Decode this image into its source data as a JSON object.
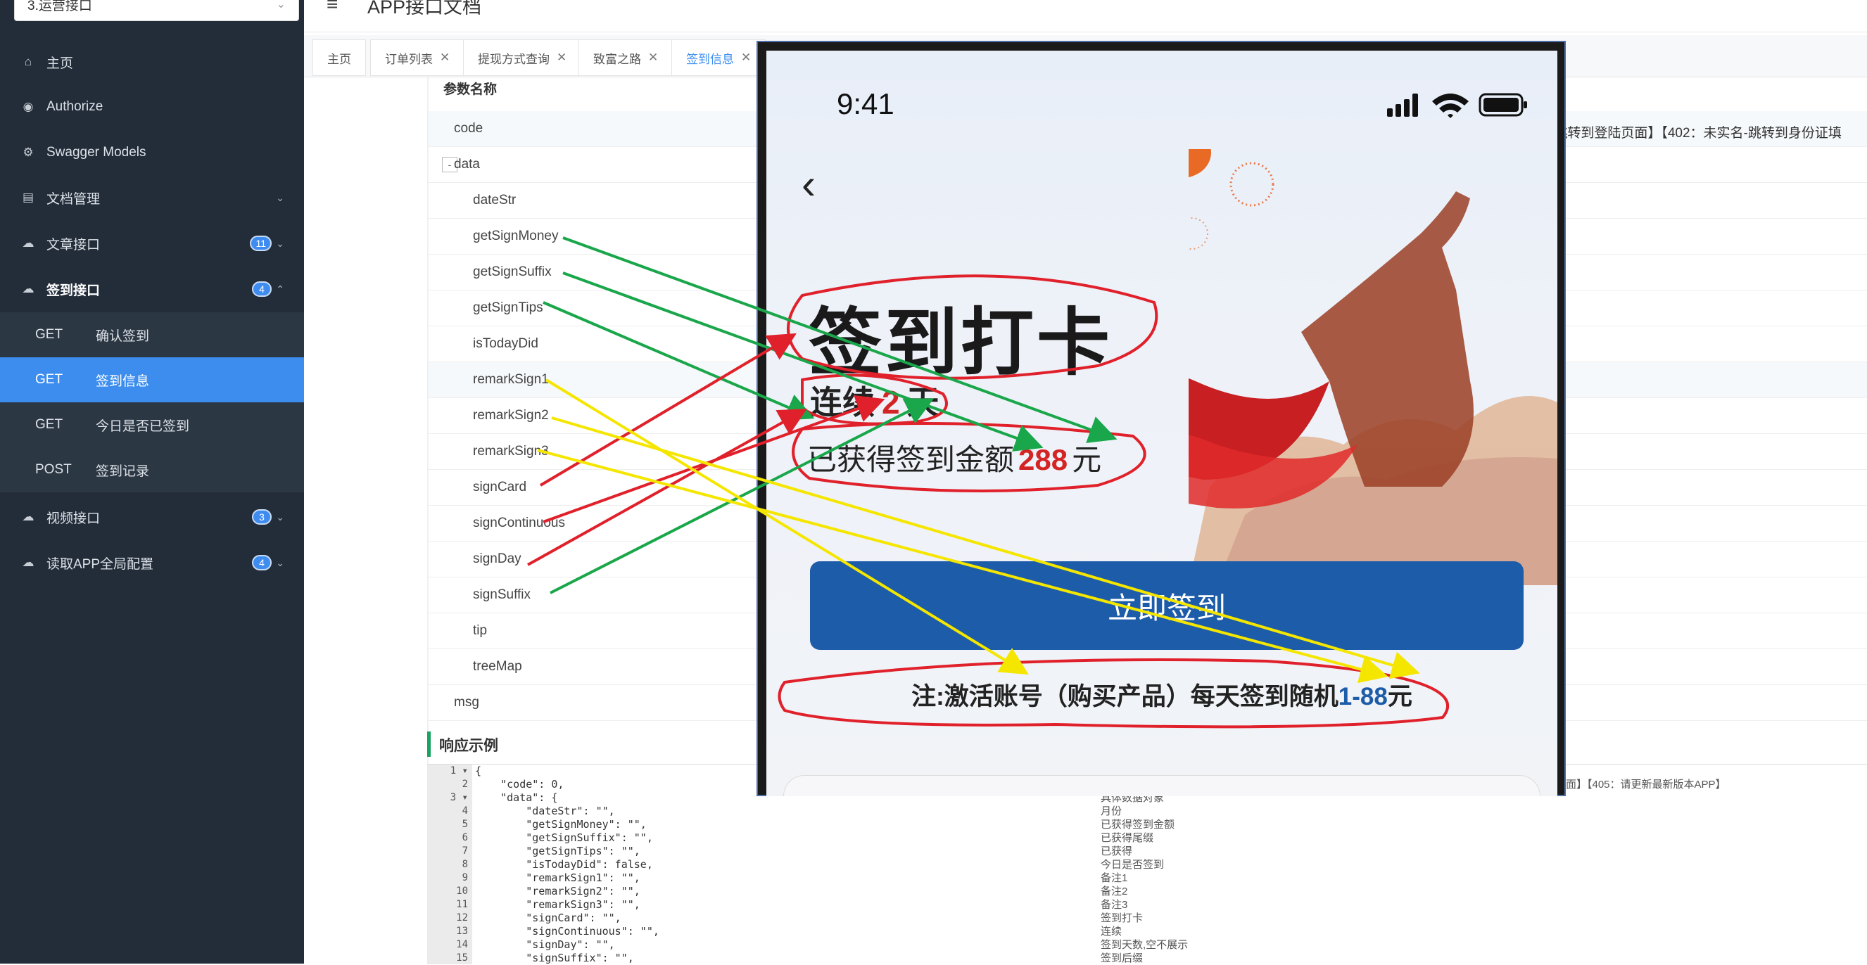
{
  "group_select": {
    "value": "3.运营接口"
  },
  "sidebar": {
    "items": [
      {
        "label": "主页",
        "icon": "home-icon"
      },
      {
        "label": "Authorize",
        "icon": "lock-icon"
      },
      {
        "label": "Swagger Models",
        "icon": "gear-icon"
      },
      {
        "label": "文档管理",
        "icon": "document-icon"
      },
      {
        "label": "文章接口",
        "icon": "cloud-icon",
        "badge": "11"
      },
      {
        "label": "签到接口",
        "icon": "cloud-icon",
        "badge": "4"
      },
      {
        "label": "视频接口",
        "icon": "cloud-icon",
        "badge": "3"
      },
      {
        "label": "读取APP全局配置",
        "icon": "cloud-icon",
        "badge": "4"
      }
    ],
    "sub_items": [
      {
        "method": "GET",
        "name": "确认签到"
      },
      {
        "method": "GET",
        "name": "签到信息"
      },
      {
        "method": "GET",
        "name": "今日是否已签到"
      },
      {
        "method": "POST",
        "name": "签到记录"
      }
    ],
    "accent": "#3c8dee",
    "bg": "#232d3a"
  },
  "header": {
    "title": "APP接口文档"
  },
  "tabs": [
    {
      "label": "主页",
      "closable": false
    },
    {
      "label": "订单列表",
      "closable": true
    },
    {
      "label": "提现方式查询",
      "closable": true
    },
    {
      "label": "致富之路",
      "closable": true
    },
    {
      "label": "签到信息",
      "closable": true
    }
  ],
  "params": {
    "header": "参数名称",
    "rows": [
      "code",
      "data",
      "dateStr",
      "getSignMoney",
      "getSignSuffix",
      "getSignTips",
      "isTodayDid",
      "remarkSign1",
      "remarkSign2",
      "remarkSign3",
      "signCard",
      "signContinuous",
      "signDay",
      "signSuffix",
      "tip",
      "treeMap",
      "msg"
    ],
    "code_desc": "-跳转到登陆页面】【402：未实名-跳转到身份证填"
  },
  "response": {
    "title": "响应示例",
    "lines": [
      {
        "t": "{"
      },
      {
        "t": "    \"code\": 0,"
      },
      {
        "t": "    \"data\": {"
      },
      {
        "t": "        \"dateStr\": \"\","
      },
      {
        "t": "        \"getSignMoney\": \"\","
      },
      {
        "t": "        \"getSignSuffix\": \"\","
      },
      {
        "t": "        \"getSignTips\": \"\","
      },
      {
        "t": "        \"isTodayDid\": false,"
      },
      {
        "t": "        \"remarkSign1\": \"\","
      },
      {
        "t": "        \"remarkSign2\": \"\","
      },
      {
        "t": "        \"remarkSign3\": \"\","
      },
      {
        "t": "        \"signCard\": \"\","
      },
      {
        "t": "        \"signContinuous\": \"\","
      },
      {
        "t": "        \"signDay\": \"\","
      },
      {
        "t": "        \"signSuffix\": \"\","
      }
    ],
    "descs": [
      "具体数据对象",
      "月份",
      "已获得签到金额",
      "已获得尾缀",
      "已获得",
      "今日是否签到",
      "备注1",
      "备注2",
      "备注3",
      "签到打卡",
      "连续",
      "签到天数,空不展示",
      "签到后缀"
    ],
    "msg_desc": "页面】【405：请更新最新版本APP】"
  },
  "phone": {
    "time": "9:41",
    "title": "签到打卡",
    "streak_prefix": "连续",
    "streak_days": "2",
    "streak_suffix": "天",
    "earned_prefix": "已获得签到金额",
    "earned_amount": "288",
    "earned_suffix": "元",
    "button": "立即签到",
    "note_prefix": "注:激活账号（购买产品）每天签到随机",
    "note_range": "1-88",
    "note_suffix": "元"
  },
  "annotation_colors": {
    "green": "#1aa64a",
    "red": "#e0202a",
    "yellow": "#f5e600"
  }
}
